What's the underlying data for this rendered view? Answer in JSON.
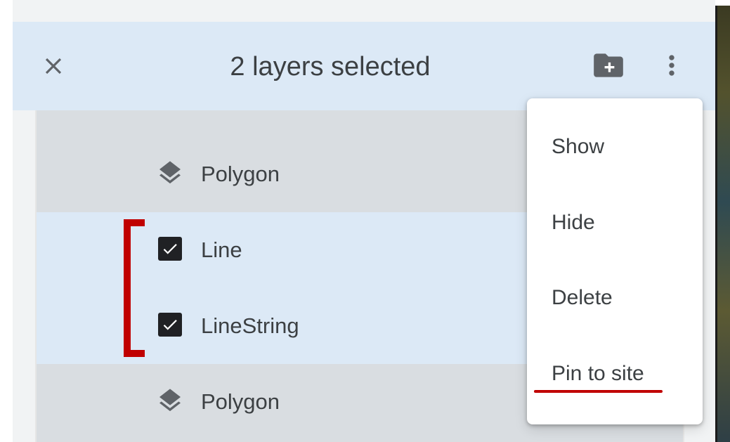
{
  "header": {
    "title": "2 layers selected",
    "close_icon": "close-icon",
    "add_folder_icon": "create-new-folder-icon",
    "more_icon": "more-vert-icon"
  },
  "layers": [
    {
      "label": "Polygon",
      "state": "unselected",
      "icon": "layers-icon"
    },
    {
      "label": "Line",
      "state": "selected",
      "icon": "checkbox-checked-icon"
    },
    {
      "label": "LineString",
      "state": "selected",
      "icon": "checkbox-checked-icon"
    },
    {
      "label": "Polygon",
      "state": "unselected",
      "icon": "layers-icon"
    }
  ],
  "menu": {
    "items": [
      {
        "label": "Show"
      },
      {
        "label": "Hide"
      },
      {
        "label": "Delete"
      },
      {
        "label": "Pin to site"
      }
    ]
  },
  "annotations": {
    "bracket_color": "#c00000",
    "underline_color": "#c00000"
  },
  "colors": {
    "header_bg": "#dce9f6",
    "selected_row_bg": "#dce9f6",
    "unselected_row_bg": "#d9dde1",
    "text": "#3c4043",
    "icon": "#5f6368"
  }
}
